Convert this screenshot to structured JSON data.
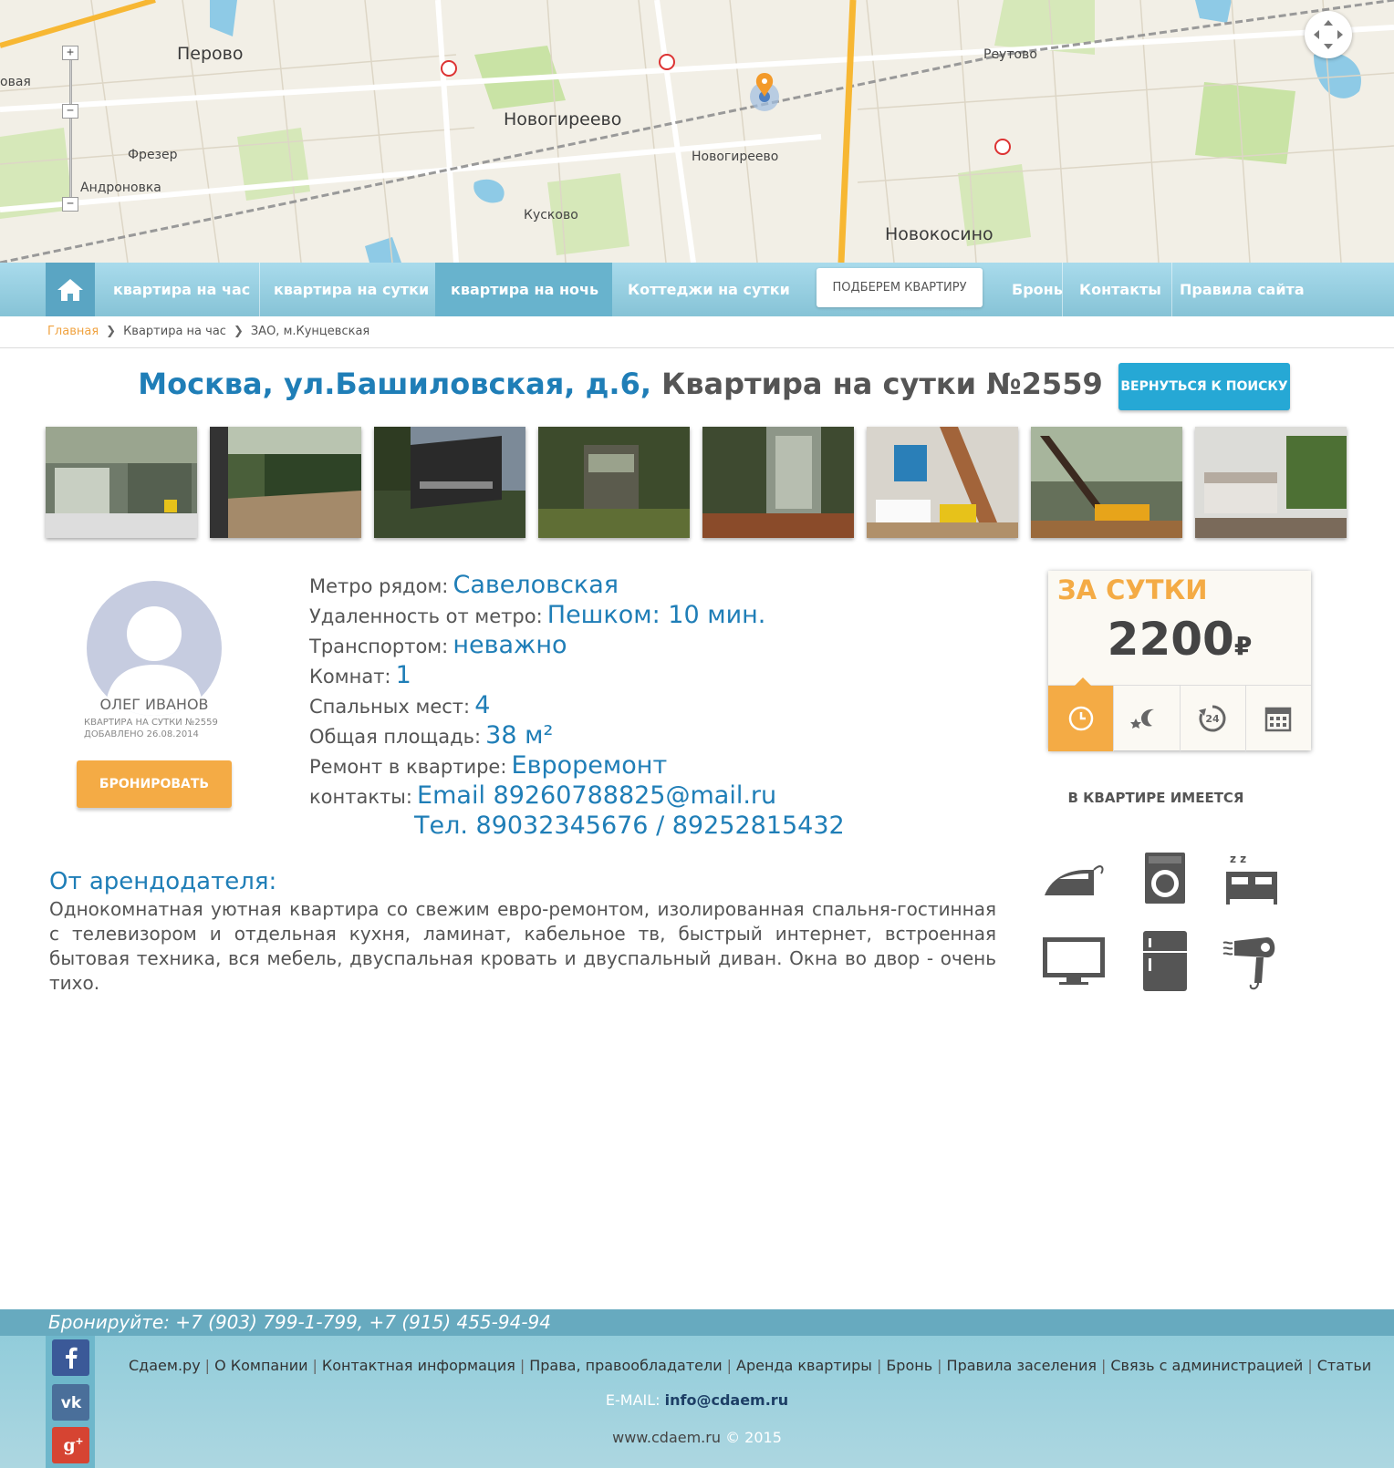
{
  "map": {
    "labels": {
      "perovo": "Перово",
      "novogireevo": "Новогиреево",
      "novokosino": "Новокосино",
      "reutovo": "Реутово",
      "fre zer": "Фрезер",
      "andronovka": "Андроновка",
      "kuskovo": "Кусково",
      "novogireevo_st": "Новогиреево",
      "left_edge": "овая"
    },
    "zoom_in": "+",
    "zoom_mid": "−",
    "zoom_out": "−"
  },
  "nav": {
    "items": [
      {
        "label": "квартира на час"
      },
      {
        "label": "квартира на сутки"
      },
      {
        "label": "квартира на ночь",
        "active": true
      },
      {
        "label": "Коттеджи на сутки"
      }
    ],
    "cta": "ПОДБЕРЕМ КВАРТИРУ",
    "right": [
      {
        "label": "Бронь"
      },
      {
        "label": "Контакты"
      },
      {
        "label": "Правила сайта"
      }
    ],
    "home_icon": "home-icon"
  },
  "breadcrumb": [
    "Главная",
    "Квартира на час",
    "ЗАО, м.Кунцевская"
  ],
  "title": {
    "address": "Москва, ул.Башиловская, д.6,",
    "rest": "Квартира на сутки №2559"
  },
  "back_button": "ВЕРНУТЬСЯ К ПОИСКУ",
  "owner": {
    "name": "ОЛЕГ ИВАНОВ",
    "listing": "КВАРТИРА НА СУТКИ №2559",
    "added": "ДОБАВЛЕНО 26.08.2014",
    "book_button": "БРОНИРОВАТЬ"
  },
  "details": [
    {
      "label": "Метро рядом:",
      "value": "Савеловская"
    },
    {
      "label": "Удаленность от метро:",
      "value": "Пешком: 10 мин."
    },
    {
      "label": "Транспортом:",
      "value": "неважно"
    },
    {
      "label": "Комнат:",
      "value": "1"
    },
    {
      "label": "Спальных мест:",
      "value": "4"
    },
    {
      "label": "Общая площадь:",
      "value": "38 м²"
    },
    {
      "label": "Ремонт в квартире:",
      "value": "Евроремонт"
    },
    {
      "label": "контакты:",
      "value": "Email 89260788825@mail.ru"
    },
    {
      "label": "",
      "value": "Тел. 89032345676 / 89252815432"
    }
  ],
  "price": {
    "title": "ЗА СУТКИ",
    "value": "2200",
    "currency": "₽",
    "tabs": [
      "clock-icon",
      "night-icon",
      "24h-icon",
      "calendar-icon"
    ],
    "accent": "#f4ab45"
  },
  "amenities": {
    "title": "В КВАРТИРЕ ИМЕЕТСЯ",
    "items": [
      "iron-icon",
      "washing-machine-icon",
      "bed-icon",
      "tv-icon",
      "fridge-icon",
      "hair-dryer-icon"
    ]
  },
  "description": {
    "title": "От арендодателя:",
    "text": "Однокомнатная уютная квартира со свежим евро-ремонтом, изолированная спальня-гостинная с телевизором и отдельная кухня, ламинат, кабельное тв, быстрый интернет, встроенная бытовая техника, вся мебель, двуспальная кровать и двуспальный диван. Окна во двор - очень тихо."
  },
  "footer": {
    "phone": "Бронируйте: +7 (903) 799-1-799, +7 (915) 455-94-94",
    "links": [
      "Сдаем.ру",
      "О Компании",
      "Контактная информация",
      "Права, правообладатели",
      "Аренда квартиры",
      "Бронь",
      "Правила заселения",
      "Связь с администрацией",
      "Статьи"
    ],
    "email_label": "E-MAIL:",
    "email": "info@cdaem.ru",
    "site": "www.cdaem.ru",
    "copyright": "© 2015",
    "social": [
      "facebook-icon",
      "vk-icon",
      "google-plus-icon"
    ]
  },
  "colors": {
    "primary_blue": "#1f7eb7",
    "button_blue": "#26a8d5",
    "orange": "#f4ab45",
    "nav": "#86c3d6"
  }
}
